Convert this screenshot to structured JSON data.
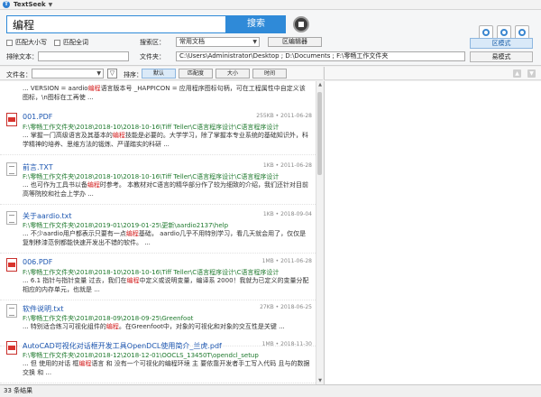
{
  "app": {
    "title": "TextSeek",
    "logo_letter": "T",
    "menu_arrow": "▼"
  },
  "search": {
    "query": "编程",
    "button_label": "搜索"
  },
  "options": {
    "match_case": "匹配大小写",
    "match_whole": "匹配全词",
    "exclude_label": "排除文本：",
    "range_label": "搜索区：",
    "range_value": "常用文档",
    "range_editor": "区编辑器",
    "folder_label": "文件夹：",
    "folder_value": "C:\\Users\\Administrator\\Desktop ; D:\\Documents ; F:\\零畅工作文件夹"
  },
  "modes": {
    "area_mode": "区模式",
    "easy_mode": "易模式"
  },
  "filter": {
    "filename_label": "文件名：",
    "filter_icon": "▽",
    "sort_label": "排序：",
    "sort_buttons": [
      "默认",
      "匹配度",
      "大小",
      "时间"
    ]
  },
  "results": {
    "partial": {
      "snippet_before": "... VERSION = aardio",
      "snippet_hl": "编程",
      "snippet_after": "语言版本号 _HAPPICON = 应用程序图标句柄，可在工程属性中自定义该图标，\\n图标在工再使 ..."
    },
    "items": [
      {
        "type": "pdf",
        "name": "001.PDF",
        "meta": "255KB  •  2011-06-28",
        "path": "F:\\零畅工作文件夹\\2018\\2018-10\\2018-10-16\\Tiff Teller\\C语言程序设计\\C语言程序设计",
        "pre": "... 掌握一门高级语言及其基本的",
        "hl": "编程",
        "post": "技能是必要的。大学学习，除了掌握本专业系统的基础知识外，科学精神的培养、思维方法的锻炼、严谨踏实的科研 ..."
      },
      {
        "type": "txt",
        "name": "前言.TXT",
        "meta": "1KB  •  2011-06-28",
        "path": "F:\\零畅工作文件夹\\2018\\2018-10\\2018-10-16\\Tiff Teller\\C语言程序设计\\C语言程序设计",
        "pre": "... 也可作为工具书以备",
        "hl": "编程",
        "post": "时参考。 本教材对C语言的精华部分作了较为细致的介绍，我们还针对目前高等院校和社会上学办 ..."
      },
      {
        "type": "txt",
        "name": "关于aardio.txt",
        "meta": "1KB  •  2018-09-04",
        "path": "F:\\零畅工作文件夹\\2018\\2019-01\\2019-01-25\\更新\\aardio2137\\help",
        "pre": "... 不少aardio用户都表示只要有一点",
        "hl": "编程",
        "post": "基础， aardio几乎不用特别学习，看几天就会用了，仅仅是复制移漆范例都能快速开发出不错的软件。 ..."
      },
      {
        "type": "pdf",
        "name": "006.PDF",
        "meta": "1MB  •  2011-06-28",
        "path": "F:\\零畅工作文件夹\\2018\\2018-10\\2018-10-16\\Tiff Teller\\C语言程序设计\\C语言程序设计",
        "pre": "... 6.1 指针与指针变量 过去，我们在",
        "hl": "编程",
        "post": "中定义或说明变量，编译系 2000！我就为已定义的变量分配相应的内存单元，也就是 ..."
      },
      {
        "type": "txt",
        "name": "软件说明.txt",
        "meta": "27KB  •  2018-06-25",
        "path": "F:\\零畅工作文件夹\\2018\\2018-09\\2018-09-25\\Greenfoot",
        "pre": "... 特别适合练习可视化组件的",
        "hl": "编程",
        "post": "。在Greenfoot中，对象的可视化和对象的交互性是关键 ..."
      },
      {
        "type": "pdf",
        "name": "AutoCAD可视化对话框开发工具OpenDCL使用简介_兰虎.pdf",
        "meta": "1MB  •  2018-11-30",
        "path": "F:\\零畅工作文件夹\\2018\\2018-12\\2018-12-01\\OOCLS_13450T\\opendcl_setup",
        "pre": "... 但 使用的对话 框",
        "hl": "编程",
        "post": "语言 和 没有一个可视化的编程环境 主 要依靠开发者手工写入代码 且与的数据交换 和 ..."
      }
    ]
  },
  "status": {
    "count": "33 条结果"
  },
  "preview": {
    "up_arrow": "▲",
    "down_arrow": "▼"
  }
}
